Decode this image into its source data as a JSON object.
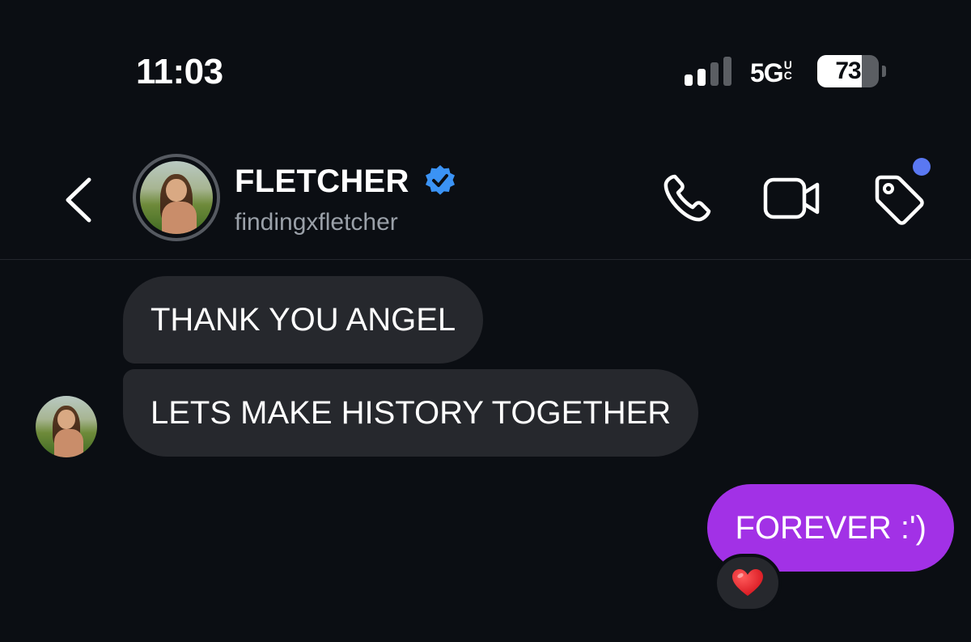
{
  "status_bar": {
    "time": "11:03",
    "network": "5G",
    "network_sub_top": "U",
    "network_sub_bottom": "C",
    "battery_level": "73",
    "battery_fraction": 0.73,
    "signal_bars_active": 2,
    "signal_bars_total": 4
  },
  "header": {
    "display_name": "FLETCHER",
    "username": "findingxfletcher",
    "verified": true,
    "icons": {
      "back": "chevron-left-icon",
      "call": "phone-icon",
      "video": "video-camera-icon",
      "tag": "tag-icon"
    },
    "notification_dot_color": "#5a78f2"
  },
  "messages": [
    {
      "direction": "incoming",
      "text": "THANK YOU ANGEL"
    },
    {
      "direction": "incoming",
      "text": "LETS MAKE HISTORY TOGETHER"
    },
    {
      "direction": "outgoing",
      "text": "FOREVER :')",
      "reaction": "heart"
    }
  ],
  "colors": {
    "background": "#0b0e13",
    "incoming_bubble": "#26282d",
    "outgoing_bubble": "#a231e6",
    "verified_badge": "#3b93f5",
    "secondary_text": "#9aa0a8"
  }
}
